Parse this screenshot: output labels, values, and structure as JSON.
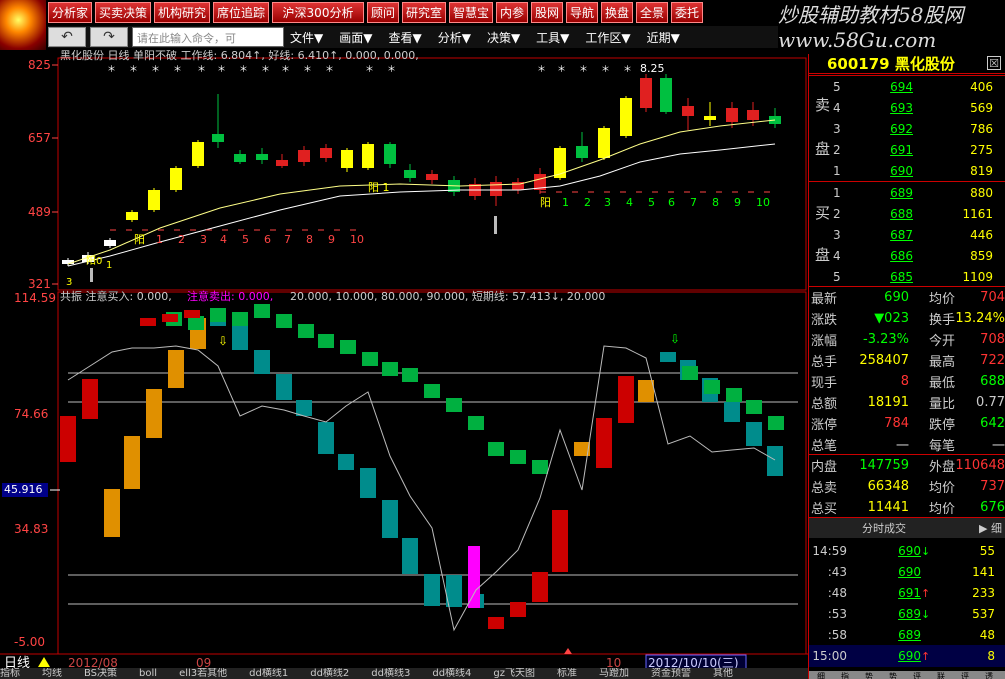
{
  "toolbar": {
    "buttons": [
      "分析家",
      "买卖决策",
      "机构研究",
      "席位追踪",
      "沪深300分析",
      "顾问",
      "研究室",
      "智慧宝",
      "内参",
      "股网",
      "导航",
      "换盘",
      "全景",
      "委托"
    ]
  },
  "nav": {
    "command_placeholder": "请在此输入命令，可",
    "menus": [
      "文件▼",
      "画面▼",
      "查看▼",
      "分析▼",
      "决策▼",
      "工具▼",
      "工作区▼",
      "近期▼"
    ]
  },
  "banner": "炒股辅助教材58股网 www.58Gu.com",
  "main_chart": {
    "title": "黑化股份 日线 单阳不破 工作线: 6.804↑, 好线: 6.410↑, 0.000, 0.000,",
    "y_labels": [
      "825",
      "657",
      "489",
      "321"
    ],
    "peak_label": "8.25",
    "count_labels_a": [
      "阳",
      "1",
      "2",
      "3",
      "4",
      "5",
      "6",
      "7",
      "8",
      "9",
      "10"
    ],
    "count_labels_b": [
      "阳",
      "1",
      "2",
      "3",
      "4",
      "5",
      "6",
      "7",
      "8",
      "9",
      "10"
    ],
    "mid_label": "阳 1",
    "low_labels": [
      "3",
      "阳0",
      "1"
    ]
  },
  "osc_chart": {
    "title_prefix": "共振 注意买入: 0.000,",
    "title_magenta": "注意卖出: 0.000,",
    "title_suffix": "20.000, 10.000, 80.000, 90.000, 短期线: 57.413↓, 20.000",
    "y_labels": [
      "114.59",
      "74.66",
      "45.916",
      "34.83",
      "-5.00"
    ]
  },
  "date_axis": [
    "日线",
    "2012/08",
    "09",
    "10",
    "2012/10/10(三)"
  ],
  "bottom_tabs": [
    "指标",
    "均线",
    "BS决策",
    "boll",
    "ell3若其他",
    "dd横线1",
    "dd横线2",
    "dd横线3",
    "dd横线4",
    "gz飞天图",
    "标准",
    "马蹬加",
    "资金预警",
    "其他"
  ],
  "quote": {
    "code_name": "600179 黑化股份",
    "close": "☒",
    "sell_label": [
      "卖",
      "盘"
    ],
    "buy_label": [
      "买",
      "盘"
    ],
    "asks": [
      {
        "lv": "5",
        "price": "694",
        "vol": "406"
      },
      {
        "lv": "4",
        "price": "693",
        "vol": "569"
      },
      {
        "lv": "3",
        "price": "692",
        "vol": "786"
      },
      {
        "lv": "2",
        "price": "691",
        "vol": "275"
      },
      {
        "lv": "1",
        "price": "690",
        "vol": "819"
      }
    ],
    "bids": [
      {
        "lv": "1",
        "price": "689",
        "vol": "880"
      },
      {
        "lv": "2",
        "price": "688",
        "vol": "1161"
      },
      {
        "lv": "3",
        "price": "687",
        "vol": "446"
      },
      {
        "lv": "4",
        "price": "686",
        "vol": "859"
      },
      {
        "lv": "5",
        "price": "685",
        "vol": "1109"
      }
    ],
    "stats": [
      {
        "l1": "最新",
        "v1": "690",
        "c1": "#0f0",
        "l2": "均价",
        "v2": "704",
        "c2": "#f33"
      },
      {
        "l1": "涨跌",
        "v1": "▼023",
        "c1": "#0f0",
        "l2": "换手",
        "v2": "13.24%",
        "c2": "#ff0"
      },
      {
        "l1": "涨幅",
        "v1": "-3.23%",
        "c1": "#0f0",
        "l2": "今开",
        "v2": "708",
        "c2": "#f33"
      },
      {
        "l1": "总手",
        "v1": "258407",
        "c1": "#ff0",
        "l2": "最高",
        "v2": "722",
        "c2": "#f33"
      },
      {
        "l1": "现手",
        "v1": "8",
        "c1": "#f33",
        "l2": "最低",
        "v2": "688",
        "c2": "#0f0"
      },
      {
        "l1": "总额",
        "v1": "18191",
        "c1": "#ff0",
        "l2": "量比",
        "v2": "0.77",
        "c2": "#ccc"
      },
      {
        "l1": "涨停",
        "v1": "784",
        "c1": "#f33",
        "l2": "跌停",
        "v2": "642",
        "c2": "#0f0"
      },
      {
        "l1": "总笔",
        "v1": "一",
        "c1": "#ccc",
        "l2": "每笔",
        "v2": "一",
        "c2": "#ccc"
      },
      {
        "l1": "内盘",
        "v1": "147759",
        "c1": "#0f0",
        "l2": "外盘",
        "v2": "110648",
        "c2": "#f33"
      },
      {
        "l1": "总卖",
        "v1": "66348",
        "c1": "#ff0",
        "l2": "均价",
        "v2": "737",
        "c2": "#f33"
      },
      {
        "l1": "总买",
        "v1": "11441",
        "c1": "#ff0",
        "l2": "均价",
        "v2": "676",
        "c2": "#0f0"
      }
    ],
    "tick_header": "分时成交",
    "tick_header_right": "▶ 细",
    "ticks": [
      {
        "t": "14:59",
        "p": "690",
        "a": "↓",
        "ac": "#0f0",
        "v": "55"
      },
      {
        "t": ":43",
        "p": "690",
        "a": "",
        "ac": "#ccc",
        "v": "141"
      },
      {
        "t": ":48",
        "p": "691",
        "a": "↑",
        "ac": "#f33",
        "v": "233"
      },
      {
        "t": ":53",
        "p": "689",
        "a": "↓",
        "ac": "#0f0",
        "v": "537"
      },
      {
        "t": ":58",
        "p": "689",
        "a": "",
        "ac": "#ccc",
        "v": "48"
      },
      {
        "t": "15:00",
        "p": "690",
        "a": "↑",
        "ac": "#f33",
        "v": "8"
      }
    ],
    "bottom_tabs": [
      "细",
      "指",
      "势",
      "势",
      "评",
      "联",
      "评",
      "透"
    ]
  },
  "colors": {
    "up": "#e02020",
    "down": "#00c040",
    "frame": "#c00000",
    "yellow": "#ffff00",
    "orange": "#e0a000",
    "teal": "#008888",
    "magenta": "#ff00ff"
  }
}
